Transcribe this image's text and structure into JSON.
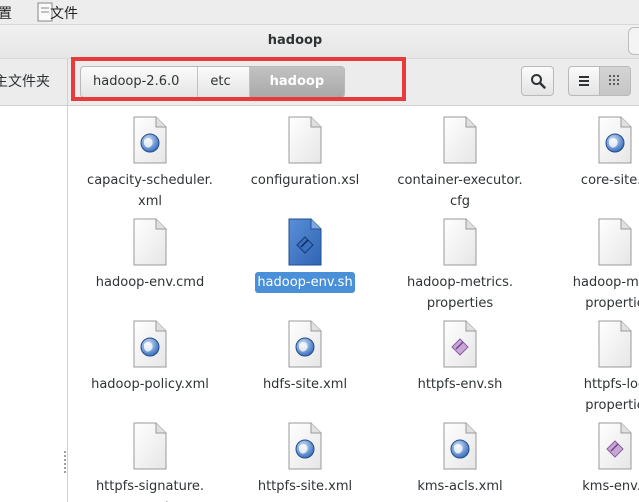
{
  "menubar": {
    "item1": "置",
    "item2": "文件"
  },
  "window": {
    "title": "hadoop"
  },
  "sidebar": {
    "label": "主文件夹"
  },
  "pathbar": {
    "crumbs": [
      "hadoop-2.6.0",
      "etc",
      "hadoop"
    ]
  },
  "toolbar": {
    "search_icon": "search-icon",
    "list_icon": "list-view-icon",
    "grid_icon": "grid-view-icon"
  },
  "colors": {
    "selection": "#4a90d9",
    "annotation_box": "#e8393b"
  },
  "files": [
    {
      "label": "capacity-scheduler.\nxml",
      "icon": "xml-file-icon",
      "selected": false
    },
    {
      "label": "configuration.xsl",
      "icon": "text-file-icon",
      "selected": false
    },
    {
      "label": "container-executor.\ncfg",
      "icon": "text-file-icon",
      "selected": false
    },
    {
      "label": "core-site.x",
      "icon": "xml-file-icon",
      "selected": false
    },
    {
      "label": "hadoop-env.cmd",
      "icon": "text-file-icon",
      "selected": false
    },
    {
      "label": "hadoop-env.sh",
      "icon": "shell-script-icon",
      "selected": true
    },
    {
      "label": "hadoop-metrics.\nproperties",
      "icon": "text-file-icon",
      "selected": false
    },
    {
      "label": "hadoop-metr\npropertie",
      "icon": "text-file-icon",
      "selected": false
    },
    {
      "label": "hadoop-policy.xml",
      "icon": "xml-file-icon",
      "selected": false
    },
    {
      "label": "hdfs-site.xml",
      "icon": "xml-file-icon",
      "selected": false
    },
    {
      "label": "httpfs-env.sh",
      "icon": "shell-script-icon",
      "selected": false
    },
    {
      "label": "httpfs-log\npropertie",
      "icon": "text-file-icon",
      "selected": false
    },
    {
      "label": "httpfs-signature.\nsecret",
      "icon": "text-file-icon",
      "selected": false
    },
    {
      "label": "httpfs-site.xml",
      "icon": "xml-file-icon",
      "selected": false
    },
    {
      "label": "kms-acls.xml",
      "icon": "xml-file-icon",
      "selected": false
    },
    {
      "label": "kms-env.s",
      "icon": "shell-script-icon",
      "selected": false
    }
  ]
}
